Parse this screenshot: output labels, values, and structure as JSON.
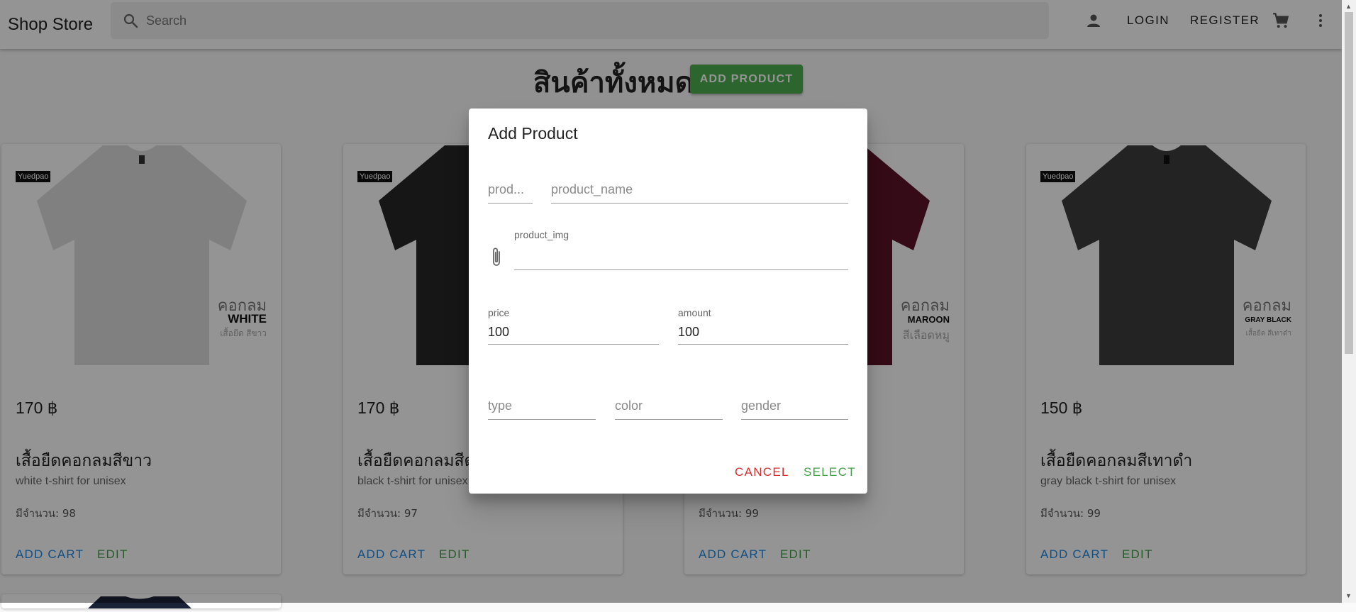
{
  "appbar": {
    "brand": "Shop Store",
    "search_placeholder": "Search",
    "login_label": "LOGIN",
    "register_label": "REGISTER",
    "icons": [
      "search-icon",
      "account-icon",
      "cart-icon",
      "more-vert-icon"
    ]
  },
  "main": {
    "title": "สินค้าทั้งหมด",
    "add_product_label": "ADD PRODUCT"
  },
  "products": [
    {
      "tag": "Yuedpao",
      "side_th": "คอกลม",
      "side_en": "WHITE",
      "side_sub": "เสื้อยืด สีขาว",
      "price": "170 ฿",
      "name": "เสื้อยืดคอกลมสีขาว",
      "desc": "white t-shirt for unisex",
      "stock": "มีจำนวน: 98",
      "add_cart": "ADD CART",
      "edit": "EDIT",
      "shirt_color": "#dcdcdc"
    },
    {
      "tag": "Yuedpao",
      "side_th": "",
      "side_en": "",
      "side_sub": "",
      "price": "170 ฿",
      "name": "เสื้อยืดคอกลมสีด",
      "desc": "black t-shirt for unisex",
      "stock": "มีจำนวน: 97",
      "add_cart": "ADD CART",
      "edit": "EDIT",
      "shirt_color": "#262626"
    },
    {
      "tag": "",
      "side_th": "คอกลม",
      "side_en": "MAROON",
      "side_sub": "สีเลือดหมู",
      "price": "",
      "name": "",
      "desc": "",
      "stock": "มีจำนวน: 99",
      "add_cart": "ADD CART",
      "edit": "EDIT",
      "shirt_color": "#5a1428"
    },
    {
      "tag": "Yuedpao",
      "side_th": "คอกลม",
      "side_en": "GRAY BLACK",
      "side_sub": "เสื้อยืด สีเทาดำ",
      "price": "150 ฿",
      "name": "เสื้อยืดคอกลมสีเทาดำ",
      "desc": "gray black t-shirt for unisex",
      "stock": "มีจำนวน: 99",
      "add_cart": "ADD CART",
      "edit": "EDIT",
      "shirt_color": "#3d3d3d"
    }
  ],
  "dialog": {
    "title": "Add Product",
    "product_id_placeholder": "prod...",
    "product_name_placeholder": "product_name",
    "product_img_label": "product_img",
    "price_label": "price",
    "price_value": "100",
    "amount_label": "amount",
    "amount_value": "100",
    "type_placeholder": "type",
    "color_placeholder": "color",
    "gender_placeholder": "gender",
    "cancel_label": "CANCEL",
    "select_label": "SELECT"
  },
  "colors": {
    "cancel": "#d32f2f",
    "select": "#43a047",
    "add_cart": "#1e88e5",
    "edit": "#43a047",
    "add_product_bg": "#4caf50"
  }
}
